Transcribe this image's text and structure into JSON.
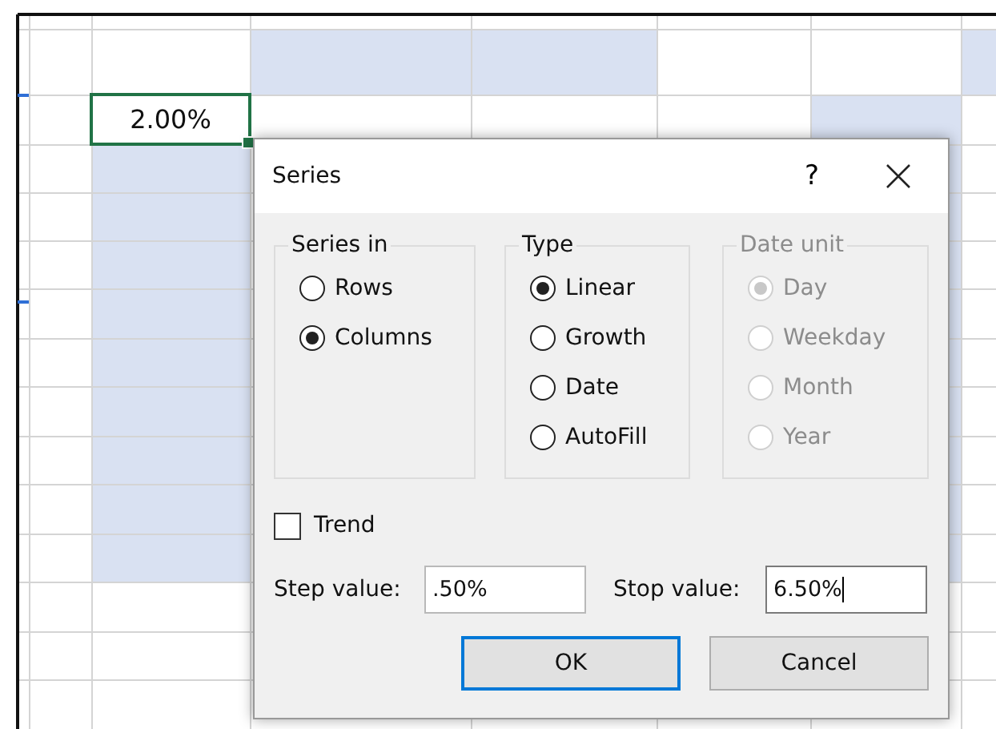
{
  "sheet": {
    "active_cell": {
      "text": "2.00%"
    }
  },
  "dialog": {
    "title": "Series",
    "help_button": "?",
    "groups": [
      {
        "title": "Series in",
        "disabled": false,
        "options": [
          {
            "label": "Rows",
            "selected": false
          },
          {
            "label": "Columns",
            "selected": true
          }
        ]
      },
      {
        "title": "Type",
        "disabled": false,
        "options": [
          {
            "label": "Linear",
            "selected": true
          },
          {
            "label": "Growth",
            "selected": false
          },
          {
            "label": "Date",
            "selected": false
          },
          {
            "label": "AutoFill",
            "selected": false
          }
        ]
      },
      {
        "title": "Date unit",
        "disabled": true,
        "options": [
          {
            "label": "Day",
            "selected": true
          },
          {
            "label": "Weekday",
            "selected": false
          },
          {
            "label": "Month",
            "selected": false
          },
          {
            "label": "Year",
            "selected": false
          }
        ]
      }
    ],
    "trend": {
      "label": "Trend",
      "checked": false
    },
    "fields": [
      {
        "label": "Step value:",
        "value": ".50%",
        "focused": false
      },
      {
        "label": "Stop value:",
        "value": "6.50%",
        "focused": true
      }
    ],
    "buttons": [
      {
        "label": "OK",
        "default": true
      },
      {
        "label": "Cancel",
        "default": false
      }
    ]
  }
}
